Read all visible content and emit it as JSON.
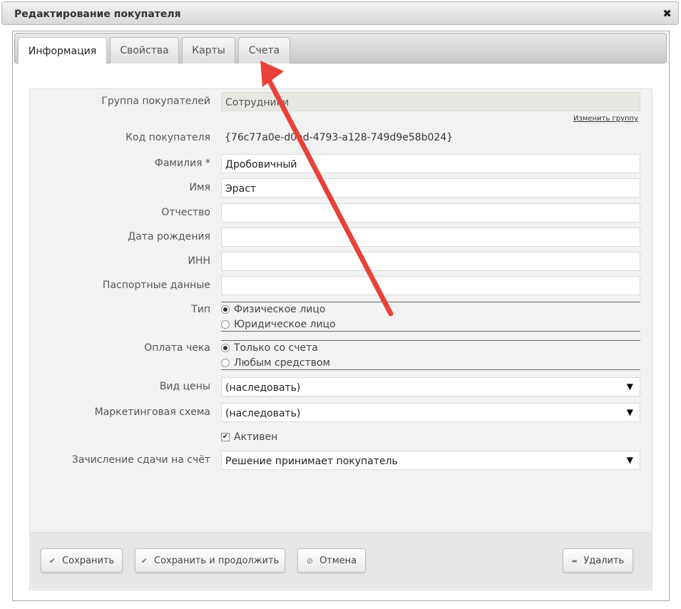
{
  "window": {
    "title": "Редактирование покупателя",
    "close_icon": "✖"
  },
  "tabs": [
    {
      "label": "Информация",
      "active": true
    },
    {
      "label": "Свойства",
      "active": false
    },
    {
      "label": "Карты",
      "active": false
    },
    {
      "label": "Счета",
      "active": false
    }
  ],
  "form": {
    "group": {
      "label": "Группа покупателей",
      "value": "Сотрудники",
      "change_link": "Изменить группу"
    },
    "code": {
      "label": "Код покупателя",
      "value": "{76c77a0e-d0ad-4793-a128-749d9e58b024}"
    },
    "surname": {
      "label": "Фамилия *",
      "value": "Дробовичный"
    },
    "name": {
      "label": "Имя",
      "value": "Эраст"
    },
    "patronymic": {
      "label": "Отчество",
      "value": ""
    },
    "birthdate": {
      "label": "Дата рождения",
      "value": ""
    },
    "inn": {
      "label": "ИНН",
      "value": ""
    },
    "passport": {
      "label": "Паспортные данные",
      "value": ""
    },
    "type": {
      "label": "Тип",
      "options": [
        "Физическое лицо",
        "Юридическое лицо"
      ],
      "selected": 0
    },
    "payment": {
      "label": "Оплата чека",
      "options": [
        "Только со счета",
        "Любым средством"
      ],
      "selected": 0
    },
    "price_type": {
      "label": "Вид цены",
      "value": "(наследовать)"
    },
    "marketing": {
      "label": "Маркетинговая схема",
      "value": "(наследовать)"
    },
    "active": {
      "label": "Активен",
      "checked": true
    },
    "change_credit": {
      "label": "Зачисление сдачи на счёт",
      "value": "Решение принимает покупатель"
    }
  },
  "buttons": {
    "save": "Сохранить",
    "save_continue": "Сохранить и продолжить",
    "cancel": "Отмена",
    "delete": "Удалить"
  },
  "icons": {
    "check": "✔",
    "cancel": "⊘",
    "minus": "▬",
    "dropdown": "▼"
  },
  "colors": {
    "annotation_arrow": "#e8413a"
  }
}
